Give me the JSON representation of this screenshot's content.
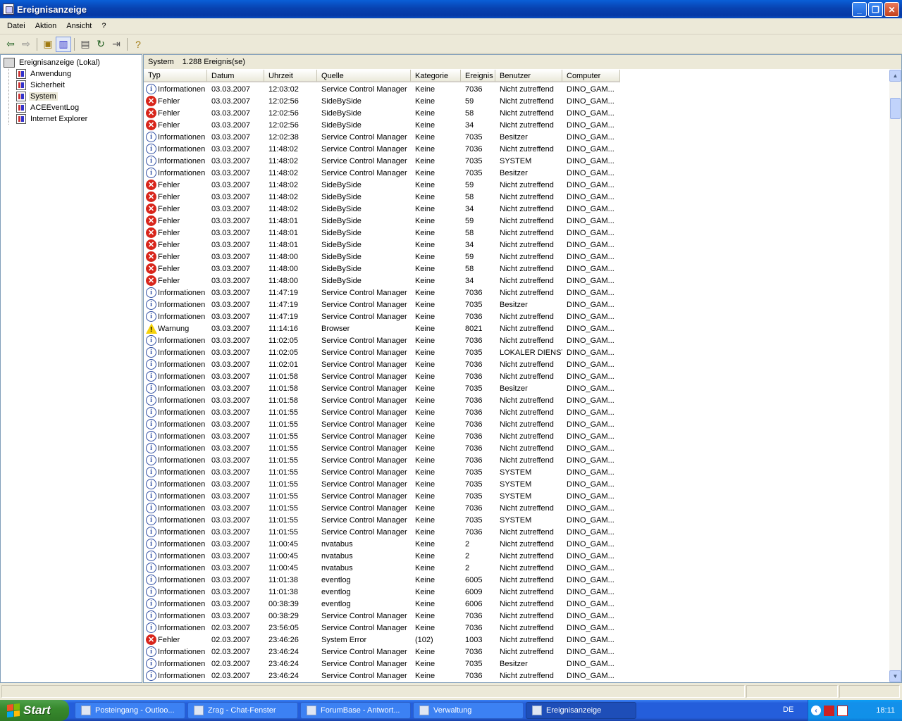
{
  "window": {
    "title": "Ereignisanzeige"
  },
  "menu": [
    "Datei",
    "Aktion",
    "Ansicht",
    "?"
  ],
  "tree": {
    "root": "Ereignisanzeige (Lokal)",
    "children": [
      "Anwendung",
      "Sicherheit",
      "System",
      "ACEEventLog",
      "Internet Explorer"
    ],
    "selected": "System"
  },
  "list": {
    "caption_name": "System",
    "caption_count": "1.288 Ereignis(se)",
    "columns": [
      "Typ",
      "Datum",
      "Uhrzeit",
      "Quelle",
      "Kategorie",
      "Ereignis",
      "Benutzer",
      "Computer"
    ],
    "rows": [
      [
        "info",
        "Informationen",
        "03.03.2007",
        "12:03:02",
        "Service Control Manager",
        "Keine",
        "7036",
        "Nicht zutreffend",
        "DINO_GAM..."
      ],
      [
        "err",
        "Fehler",
        "03.03.2007",
        "12:02:56",
        "SideBySide",
        "Keine",
        "59",
        "Nicht zutreffend",
        "DINO_GAM..."
      ],
      [
        "err",
        "Fehler",
        "03.03.2007",
        "12:02:56",
        "SideBySide",
        "Keine",
        "58",
        "Nicht zutreffend",
        "DINO_GAM..."
      ],
      [
        "err",
        "Fehler",
        "03.03.2007",
        "12:02:56",
        "SideBySide",
        "Keine",
        "34",
        "Nicht zutreffend",
        "DINO_GAM..."
      ],
      [
        "info",
        "Informationen",
        "03.03.2007",
        "12:02:38",
        "Service Control Manager",
        "Keine",
        "7035",
        "Besitzer",
        "DINO_GAM..."
      ],
      [
        "info",
        "Informationen",
        "03.03.2007",
        "11:48:02",
        "Service Control Manager",
        "Keine",
        "7036",
        "Nicht zutreffend",
        "DINO_GAM..."
      ],
      [
        "info",
        "Informationen",
        "03.03.2007",
        "11:48:02",
        "Service Control Manager",
        "Keine",
        "7035",
        "SYSTEM",
        "DINO_GAM..."
      ],
      [
        "info",
        "Informationen",
        "03.03.2007",
        "11:48:02",
        "Service Control Manager",
        "Keine",
        "7035",
        "Besitzer",
        "DINO_GAM..."
      ],
      [
        "err",
        "Fehler",
        "03.03.2007",
        "11:48:02",
        "SideBySide",
        "Keine",
        "59",
        "Nicht zutreffend",
        "DINO_GAM..."
      ],
      [
        "err",
        "Fehler",
        "03.03.2007",
        "11:48:02",
        "SideBySide",
        "Keine",
        "58",
        "Nicht zutreffend",
        "DINO_GAM..."
      ],
      [
        "err",
        "Fehler",
        "03.03.2007",
        "11:48:02",
        "SideBySide",
        "Keine",
        "34",
        "Nicht zutreffend",
        "DINO_GAM..."
      ],
      [
        "err",
        "Fehler",
        "03.03.2007",
        "11:48:01",
        "SideBySide",
        "Keine",
        "59",
        "Nicht zutreffend",
        "DINO_GAM..."
      ],
      [
        "err",
        "Fehler",
        "03.03.2007",
        "11:48:01",
        "SideBySide",
        "Keine",
        "58",
        "Nicht zutreffend",
        "DINO_GAM..."
      ],
      [
        "err",
        "Fehler",
        "03.03.2007",
        "11:48:01",
        "SideBySide",
        "Keine",
        "34",
        "Nicht zutreffend",
        "DINO_GAM..."
      ],
      [
        "err",
        "Fehler",
        "03.03.2007",
        "11:48:00",
        "SideBySide",
        "Keine",
        "59",
        "Nicht zutreffend",
        "DINO_GAM..."
      ],
      [
        "err",
        "Fehler",
        "03.03.2007",
        "11:48:00",
        "SideBySide",
        "Keine",
        "58",
        "Nicht zutreffend",
        "DINO_GAM..."
      ],
      [
        "err",
        "Fehler",
        "03.03.2007",
        "11:48:00",
        "SideBySide",
        "Keine",
        "34",
        "Nicht zutreffend",
        "DINO_GAM..."
      ],
      [
        "info",
        "Informationen",
        "03.03.2007",
        "11:47:19",
        "Service Control Manager",
        "Keine",
        "7036",
        "Nicht zutreffend",
        "DINO_GAM..."
      ],
      [
        "info",
        "Informationen",
        "03.03.2007",
        "11:47:19",
        "Service Control Manager",
        "Keine",
        "7035",
        "Besitzer",
        "DINO_GAM..."
      ],
      [
        "info",
        "Informationen",
        "03.03.2007",
        "11:47:19",
        "Service Control Manager",
        "Keine",
        "7036",
        "Nicht zutreffend",
        "DINO_GAM..."
      ],
      [
        "warn",
        "Warnung",
        "03.03.2007",
        "11:14:16",
        "Browser",
        "Keine",
        "8021",
        "Nicht zutreffend",
        "DINO_GAM..."
      ],
      [
        "info",
        "Informationen",
        "03.03.2007",
        "11:02:05",
        "Service Control Manager",
        "Keine",
        "7036",
        "Nicht zutreffend",
        "DINO_GAM..."
      ],
      [
        "info",
        "Informationen",
        "03.03.2007",
        "11:02:05",
        "Service Control Manager",
        "Keine",
        "7035",
        "LOKALER DIENST",
        "DINO_GAM..."
      ],
      [
        "info",
        "Informationen",
        "03.03.2007",
        "11:02:01",
        "Service Control Manager",
        "Keine",
        "7036",
        "Nicht zutreffend",
        "DINO_GAM..."
      ],
      [
        "info",
        "Informationen",
        "03.03.2007",
        "11:01:58",
        "Service Control Manager",
        "Keine",
        "7036",
        "Nicht zutreffend",
        "DINO_GAM..."
      ],
      [
        "info",
        "Informationen",
        "03.03.2007",
        "11:01:58",
        "Service Control Manager",
        "Keine",
        "7035",
        "Besitzer",
        "DINO_GAM..."
      ],
      [
        "info",
        "Informationen",
        "03.03.2007",
        "11:01:58",
        "Service Control Manager",
        "Keine",
        "7036",
        "Nicht zutreffend",
        "DINO_GAM..."
      ],
      [
        "info",
        "Informationen",
        "03.03.2007",
        "11:01:55",
        "Service Control Manager",
        "Keine",
        "7036",
        "Nicht zutreffend",
        "DINO_GAM..."
      ],
      [
        "info",
        "Informationen",
        "03.03.2007",
        "11:01:55",
        "Service Control Manager",
        "Keine",
        "7036",
        "Nicht zutreffend",
        "DINO_GAM..."
      ],
      [
        "info",
        "Informationen",
        "03.03.2007",
        "11:01:55",
        "Service Control Manager",
        "Keine",
        "7036",
        "Nicht zutreffend",
        "DINO_GAM..."
      ],
      [
        "info",
        "Informationen",
        "03.03.2007",
        "11:01:55",
        "Service Control Manager",
        "Keine",
        "7036",
        "Nicht zutreffend",
        "DINO_GAM..."
      ],
      [
        "info",
        "Informationen",
        "03.03.2007",
        "11:01:55",
        "Service Control Manager",
        "Keine",
        "7036",
        "Nicht zutreffend",
        "DINO_GAM..."
      ],
      [
        "info",
        "Informationen",
        "03.03.2007",
        "11:01:55",
        "Service Control Manager",
        "Keine",
        "7035",
        "SYSTEM",
        "DINO_GAM..."
      ],
      [
        "info",
        "Informationen",
        "03.03.2007",
        "11:01:55",
        "Service Control Manager",
        "Keine",
        "7035",
        "SYSTEM",
        "DINO_GAM..."
      ],
      [
        "info",
        "Informationen",
        "03.03.2007",
        "11:01:55",
        "Service Control Manager",
        "Keine",
        "7035",
        "SYSTEM",
        "DINO_GAM..."
      ],
      [
        "info",
        "Informationen",
        "03.03.2007",
        "11:01:55",
        "Service Control Manager",
        "Keine",
        "7036",
        "Nicht zutreffend",
        "DINO_GAM..."
      ],
      [
        "info",
        "Informationen",
        "03.03.2007",
        "11:01:55",
        "Service Control Manager",
        "Keine",
        "7035",
        "SYSTEM",
        "DINO_GAM..."
      ],
      [
        "info",
        "Informationen",
        "03.03.2007",
        "11:01:55",
        "Service Control Manager",
        "Keine",
        "7036",
        "Nicht zutreffend",
        "DINO_GAM..."
      ],
      [
        "info",
        "Informationen",
        "03.03.2007",
        "11:00:45",
        "nvatabus",
        "Keine",
        "2",
        "Nicht zutreffend",
        "DINO_GAM..."
      ],
      [
        "info",
        "Informationen",
        "03.03.2007",
        "11:00:45",
        "nvatabus",
        "Keine",
        "2",
        "Nicht zutreffend",
        "DINO_GAM..."
      ],
      [
        "info",
        "Informationen",
        "03.03.2007",
        "11:00:45",
        "nvatabus",
        "Keine",
        "2",
        "Nicht zutreffend",
        "DINO_GAM..."
      ],
      [
        "info",
        "Informationen",
        "03.03.2007",
        "11:01:38",
        "eventlog",
        "Keine",
        "6005",
        "Nicht zutreffend",
        "DINO_GAM..."
      ],
      [
        "info",
        "Informationen",
        "03.03.2007",
        "11:01:38",
        "eventlog",
        "Keine",
        "6009",
        "Nicht zutreffend",
        "DINO_GAM..."
      ],
      [
        "info",
        "Informationen",
        "03.03.2007",
        "00:38:39",
        "eventlog",
        "Keine",
        "6006",
        "Nicht zutreffend",
        "DINO_GAM..."
      ],
      [
        "info",
        "Informationen",
        "03.03.2007",
        "00:38:29",
        "Service Control Manager",
        "Keine",
        "7036",
        "Nicht zutreffend",
        "DINO_GAM..."
      ],
      [
        "info",
        "Informationen",
        "02.03.2007",
        "23:56:05",
        "Service Control Manager",
        "Keine",
        "7036",
        "Nicht zutreffend",
        "DINO_GAM..."
      ],
      [
        "err",
        "Fehler",
        "02.03.2007",
        "23:46:26",
        "System Error",
        "(102)",
        "1003",
        "Nicht zutreffend",
        "DINO_GAM..."
      ],
      [
        "info",
        "Informationen",
        "02.03.2007",
        "23:46:24",
        "Service Control Manager",
        "Keine",
        "7036",
        "Nicht zutreffend",
        "DINO_GAM..."
      ],
      [
        "info",
        "Informationen",
        "02.03.2007",
        "23:46:24",
        "Service Control Manager",
        "Keine",
        "7035",
        "Besitzer",
        "DINO_GAM..."
      ],
      [
        "info",
        "Informationen",
        "02.03.2007",
        "23:46:24",
        "Service Control Manager",
        "Keine",
        "7036",
        "Nicht zutreffend",
        "DINO_GAM..."
      ]
    ]
  },
  "taskbar": {
    "start": "Start",
    "buttons": [
      "Posteingang - Outloo...",
      "Zrag - Chat-Fenster",
      "ForumBase - Antwort...",
      "Verwaltung",
      "Ereignisanzeige"
    ],
    "active": "Ereignisanzeige",
    "lang": "DE",
    "time": "18:11"
  }
}
